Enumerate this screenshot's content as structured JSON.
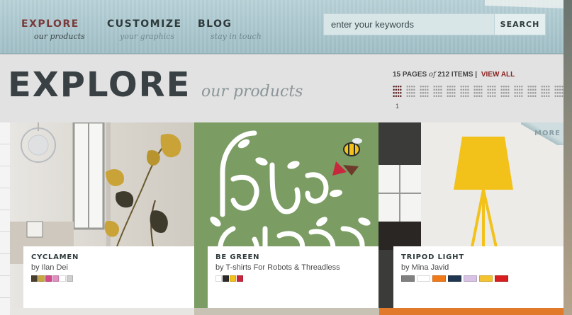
{
  "nav": {
    "items": [
      {
        "title": "EXPLORE",
        "subtitle": "our products"
      },
      {
        "title": "CUSTOMIZE",
        "subtitle": "your graphics"
      },
      {
        "title": "BLOG",
        "subtitle": "stay in touch"
      }
    ],
    "search": {
      "placeholder": "enter your keywords",
      "button": "SEARCH"
    }
  },
  "header": {
    "title": "EXPLORE",
    "subtitle": "our products",
    "pager": {
      "pages": "15 PAGES",
      "of": "of",
      "items": "212 ITEMS",
      "separator": "|",
      "view_all": "VIEW ALL",
      "current_page": "1",
      "page_count": 15
    }
  },
  "products": [
    {
      "title": "CYCLAMEN",
      "by": "by Ilan Dei",
      "swatches": [
        "#4a3f2c",
        "#c9a640",
        "#d4488c",
        "#e08fc0",
        "#ffffff",
        "#cfcfcf"
      ]
    },
    {
      "title": "BE GREEN",
      "by": "by T-shirts For Robots & Threadless",
      "swatches": [
        "#ffffff",
        "#2b2b2b",
        "#f2c21a",
        "#c8283e"
      ]
    },
    {
      "title": "TRIPOD LIGHT",
      "by": "by Mina Javid",
      "more_label": "MORE",
      "swatches": [
        "#808080",
        "#ffffff",
        "#f07a18",
        "#1f3550",
        "#d8c2e6",
        "#f4c430",
        "#d81e1e"
      ]
    }
  ],
  "colors": {
    "nav_bg": "#a9c8d0",
    "accent_red": "#8a1f1f",
    "title_dark": "#394145"
  }
}
